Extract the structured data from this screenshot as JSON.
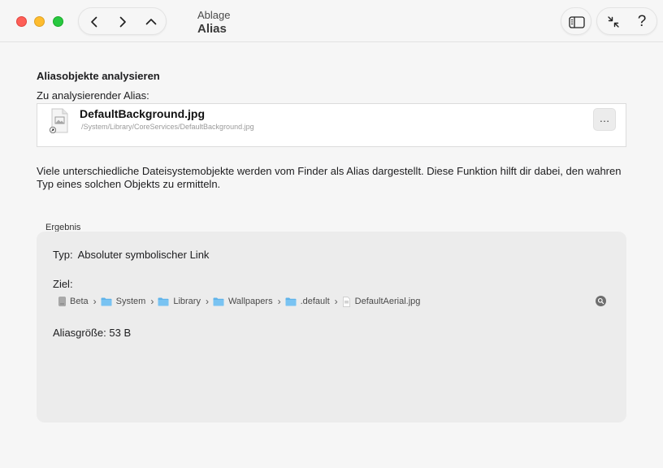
{
  "window": {
    "breadcrumb_parent": "Ablage",
    "title": "Alias",
    "help_label": "?"
  },
  "toolbar": {
    "nav_icons": [
      "back-icon",
      "forward-icon",
      "up-icon"
    ],
    "right_icons": [
      "sidebar-icon",
      "collapse-icon",
      "help-icon"
    ]
  },
  "analyze": {
    "section_title": "Aliasobjekte analysieren",
    "alias_label": "Zu analysierender Alias:",
    "file_name": "DefaultBackground.jpg",
    "file_path": "/System/Library/CoreServices/DefaultBackground.jpg",
    "more_label": "…"
  },
  "description": "Viele unterschiedliche Dateisystemobjekte werden vom Finder als Alias dargestellt. Diese Funktion hilft dir dabei, den wahren Typ eines solchen Objekts zu ermitteln.",
  "result": {
    "label": "Ergebnis",
    "type_label": "Typ:",
    "type_value": "Absoluter symbolischer Link",
    "target_label": "Ziel:",
    "path": [
      {
        "label": "Beta",
        "icon": "disk-icon"
      },
      {
        "label": "System",
        "icon": "folder-icon"
      },
      {
        "label": "Library",
        "icon": "folder-icon"
      },
      {
        "label": "Wallpapers",
        "icon": "folder-icon"
      },
      {
        "label": ".default",
        "icon": "folder-icon"
      },
      {
        "label": "DefaultAerial.jpg",
        "icon": "file-icon"
      }
    ],
    "size_label": "Aliasgröße:",
    "size_value": "53",
    "size_unit": "B"
  },
  "colors": {
    "close": "#fe5f57",
    "minimize": "#febc2e",
    "maximize": "#28c840",
    "folder": "#5fb3ea"
  }
}
